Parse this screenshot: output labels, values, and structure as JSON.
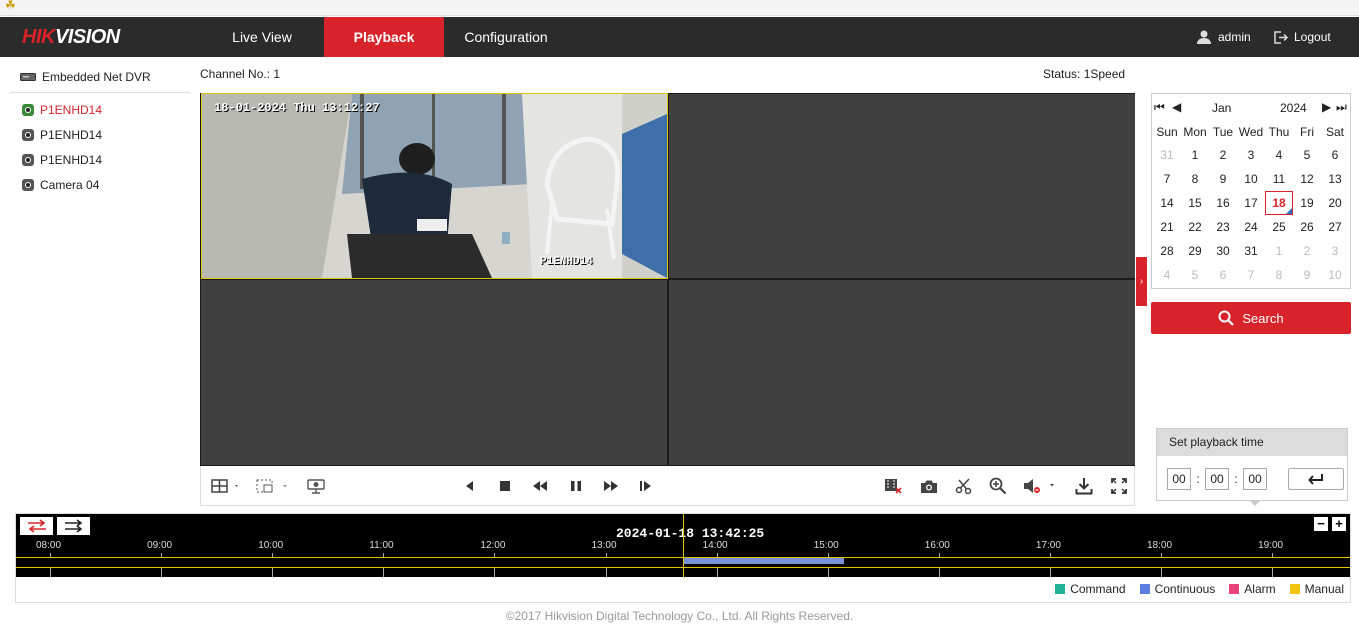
{
  "brand": {
    "logo_text_a": "HIK",
    "logo_text_b": "VISION"
  },
  "nav": {
    "live_view": "Live View",
    "playback": "Playback",
    "configuration": "Configuration"
  },
  "user": {
    "name": "admin",
    "logout": "Logout"
  },
  "sidebar": {
    "device": "Embedded Net DVR",
    "cameras": [
      {
        "label": "P1ENHD14",
        "selected": true
      },
      {
        "label": "P1ENHD14",
        "selected": false
      },
      {
        "label": "P1ENHD14",
        "selected": false
      },
      {
        "label": "Camera 04",
        "selected": false
      }
    ]
  },
  "player": {
    "channel": "Channel No.: 1",
    "status": "Status: 1Speed",
    "osd_time": "18-01-2024 Thu 13:12:27",
    "osd_name": "P1ENHD14"
  },
  "calendar": {
    "month": "Jan",
    "year": "2024",
    "weekdays": [
      "Sun",
      "Mon",
      "Tue",
      "Wed",
      "Thu",
      "Fri",
      "Sat"
    ],
    "weeks": [
      [
        "31",
        "1",
        "2",
        "3",
        "4",
        "5",
        "6"
      ],
      [
        "7",
        "8",
        "9",
        "10",
        "11",
        "12",
        "13"
      ],
      [
        "14",
        "15",
        "16",
        "17",
        "18",
        "19",
        "20"
      ],
      [
        "21",
        "22",
        "23",
        "24",
        "25",
        "26",
        "27"
      ],
      [
        "28",
        "29",
        "30",
        "31",
        "1",
        "2",
        "3"
      ],
      [
        "4",
        "5",
        "6",
        "7",
        "8",
        "9",
        "10"
      ]
    ],
    "selected_day": "18",
    "search_label": "Search"
  },
  "playback_time": {
    "title": "Set playback time",
    "hh": "00",
    "mm": "00",
    "ss": "00",
    "sep": ":"
  },
  "timeline": {
    "current": "2024-01-18 13:42:25",
    "ticks": [
      "08:00",
      "09:00",
      "10:00",
      "11:00",
      "12:00",
      "13:00",
      "14:00",
      "15:00",
      "16:00",
      "17:00",
      "18:00",
      "19:00"
    ],
    "recording": {
      "start_hour": 13.7,
      "end_hour": 15.15,
      "type": "Continuous"
    },
    "cursor_hour": 13.7
  },
  "legend": [
    {
      "label": "Command",
      "color": "#1fb39a"
    },
    {
      "label": "Continuous",
      "color": "#5b7fe0"
    },
    {
      "label": "Alarm",
      "color": "#e8437a"
    },
    {
      "label": "Manual",
      "color": "#f3c313"
    }
  ],
  "colors": {
    "accent": "#d8232a",
    "topbar": "#2b2b2b",
    "pane": "#404040",
    "selection": "#e0c400"
  },
  "footer": "©2017 Hikvision Digital Technology Co., Ltd. All Rights Reserved."
}
